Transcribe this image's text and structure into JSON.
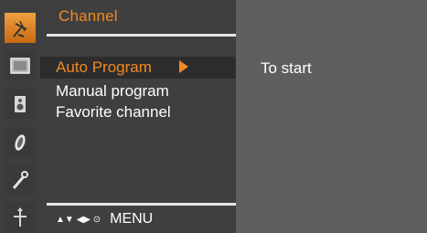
{
  "menu": {
    "title": "Channel",
    "items": [
      {
        "label": "Auto Program",
        "selected": true
      },
      {
        "label": "Manual program",
        "selected": false
      },
      {
        "label": "Favorite channel",
        "selected": false
      }
    ],
    "footer": {
      "nav_keys": "▲▼ ◀▶ ⊙",
      "menu_label": "MENU"
    }
  },
  "right_panel": {
    "hint": "To start"
  },
  "sidebar_icons": [
    {
      "name": "antenna-icon",
      "active": true
    },
    {
      "name": "picture-icon",
      "active": false
    },
    {
      "name": "speaker-icon",
      "active": false
    },
    {
      "name": "clock-icon",
      "active": false
    },
    {
      "name": "special-icon",
      "active": false
    },
    {
      "name": "screen-icon",
      "active": false
    }
  ],
  "colors": {
    "accent": "#f08a24",
    "panel": "#3f3f3f",
    "background": "#5f5f5f"
  }
}
